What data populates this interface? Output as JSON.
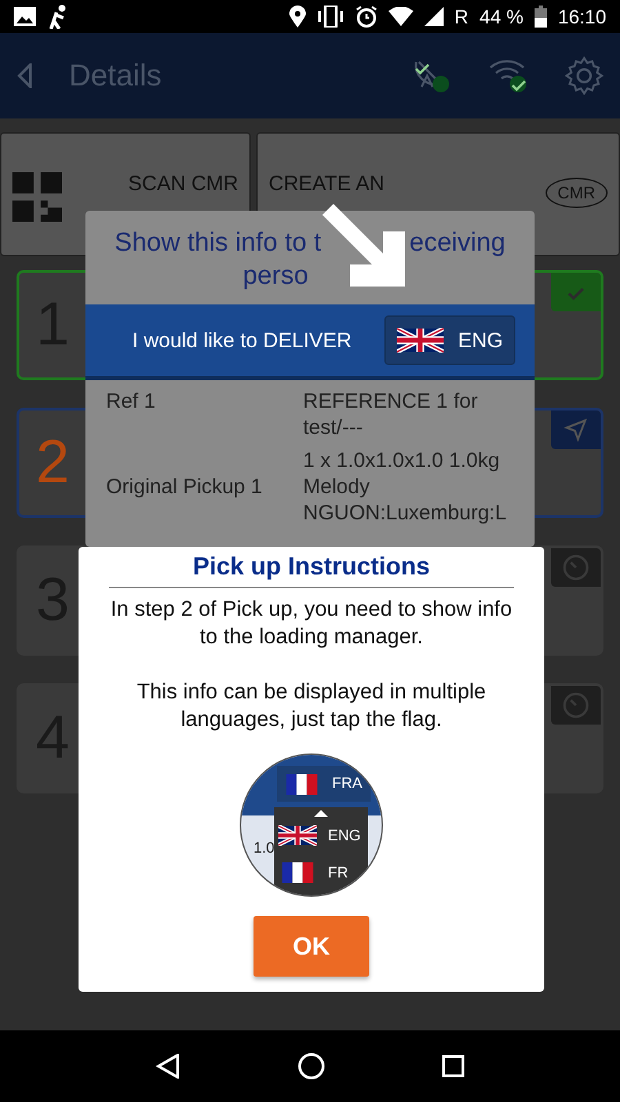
{
  "status_bar": {
    "network": "R",
    "battery": "44 %",
    "time": "16:10"
  },
  "app_bar": {
    "title": "Details"
  },
  "actions": [
    {
      "label": "SCAN CMR",
      "kind": "qr"
    },
    {
      "label": "CREATE AN",
      "kind": "cmr",
      "badge": "CMR"
    }
  ],
  "steps": [
    {
      "number": "1",
      "kind": "done"
    },
    {
      "number": "2",
      "kind": "active"
    },
    {
      "number": "3",
      "kind": "pending"
    },
    {
      "number": "4",
      "kind": "pending"
    }
  ],
  "info_card": {
    "title_lines": [
      [
        "Show this info to t",
        "eceiving"
      ],
      [
        "perso"
      ]
    ],
    "action": "I would like to DELIVER",
    "language": "ENG",
    "rows": [
      {
        "label": "Ref 1",
        "values": [
          "REFERENCE 1 for test/---",
          "1 x 1.0x1.0x1.0 1.0kg"
        ]
      },
      {
        "label": "Original Pickup 1",
        "values": [
          "Melody NGUON:Luxemburg:L"
        ]
      }
    ]
  },
  "dialog": {
    "title": "Pick up Instructions",
    "paragraphs": [
      "In step 2 of Pick up, you need to show info to the loading manager.",
      "This info can be displayed in multiple languages, just tap the flag."
    ],
    "illustration": {
      "current": "FRA",
      "options": [
        "ENG",
        "FR"
      ],
      "fragment": "1.0"
    },
    "button": "OK"
  }
}
